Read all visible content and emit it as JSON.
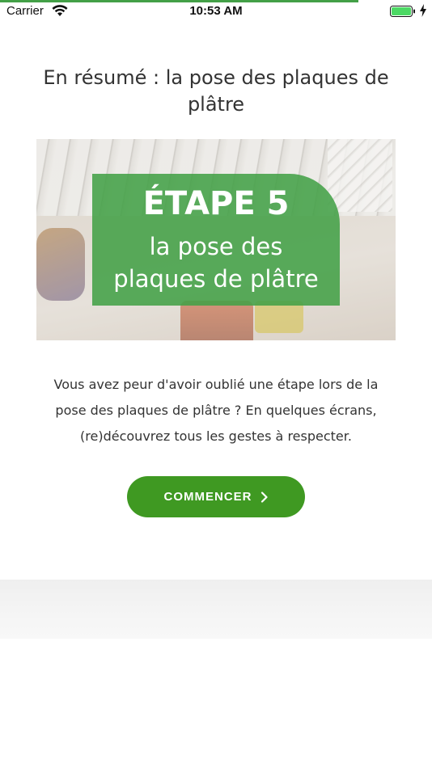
{
  "status_bar": {
    "carrier": "Carrier",
    "time": "10:53 AM",
    "progress": 0.83,
    "icons": [
      "wifi-icon",
      "battery-icon",
      "charging-bolt-icon"
    ]
  },
  "main": {
    "title": "En résumé : la pose des plaques de plâtre",
    "hero": {
      "step": "ÉTAPE 5",
      "subtitle_line1": "la pose des",
      "subtitle_line2": "plaques de plâtre"
    },
    "description": "Vous avez peur d'avoir oublié une étape lors de la pose des plaques de plâtre ? En quelques écrans, (re)découvrez tous les gestes à respecter.",
    "start_button": {
      "label": "COMMENCER",
      "icon": "chevron-right-icon"
    }
  },
  "colors": {
    "accent": "#3f9922",
    "badge": "#43a047",
    "text": "#333333"
  }
}
